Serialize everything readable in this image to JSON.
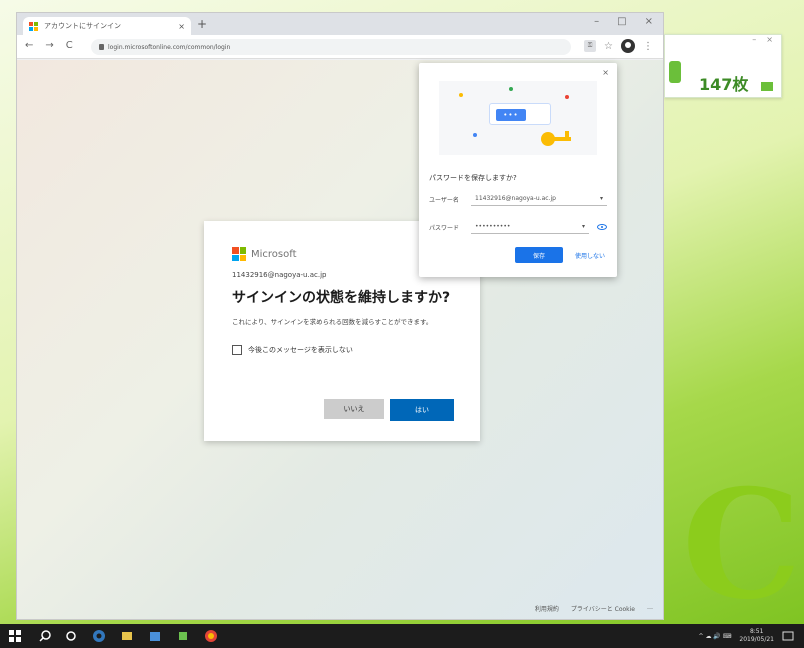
{
  "colors": {
    "accent_blue": "#0067b8",
    "chrome_blue": "#1a73e8",
    "wallpaper_green": "#8ccc1c"
  },
  "wallpaper": {
    "letter": "C"
  },
  "sticky": {
    "count": "147枚",
    "min": "–",
    "close": "×"
  },
  "browser": {
    "tab_title": "アカウントにサインイン",
    "tab_close": "×",
    "new_tab": "+",
    "window_controls": [
      "–",
      "□",
      "×"
    ],
    "nav": [
      "←",
      "→",
      "C"
    ],
    "url": "login.microsoftonline.com/common/login",
    "toolbar_key": "⚿",
    "star": "☆",
    "menu": "⋮"
  },
  "signin": {
    "brand": "Microsoft",
    "account": "11432916@nagoya-u.ac.jp",
    "heading": "サインインの状態を維持しますか?",
    "description": "これにより、サインインを求められる回数を減らすことができます。",
    "checkbox_label": "今後このメッセージを表示しない",
    "no_button": "いいえ",
    "yes_button": "はい"
  },
  "password_popup": {
    "close": "×",
    "dots": "•••",
    "title": "パスワードを保存しますか?",
    "username_label": "ユーザー名",
    "username_value": "11432916@nagoya-u.ac.jp",
    "username_caret": "▾",
    "password_label": "パスワード",
    "password_value": "••••••••••",
    "password_caret": "▾",
    "save_button": "保存",
    "never_button": "使用しない"
  },
  "footer": {
    "terms": "利用規約",
    "privacy": "プライバシーと Cookie",
    "more": "…"
  },
  "taskbar": {
    "tray_left": "^ ☁ 🔊 ⌨",
    "time": "8:51",
    "date": "2019/05/21"
  }
}
